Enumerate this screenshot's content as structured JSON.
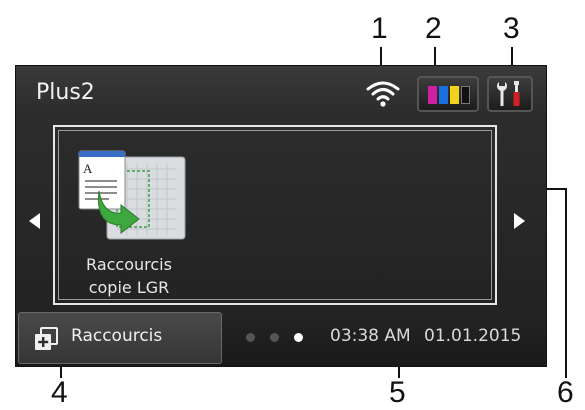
{
  "callouts": [
    "1",
    "2",
    "3",
    "4",
    "5",
    "6"
  ],
  "screen": {
    "title": "Plus2",
    "icons": {
      "wifi": "wifi-signal-icon",
      "ink": "ink-levels-icon",
      "settings": "tools-settings-icon"
    },
    "ink_colors": [
      "#d11fa3",
      "#1a6fe0",
      "#f3d21b",
      "#111111"
    ],
    "shortcut_tile": {
      "label_line1": "Raccourcis",
      "label_line2": "copie LGR"
    },
    "bottom": {
      "shortcuts_label": "Raccourcis",
      "time": "03:38 AM",
      "date": "01.01.2015",
      "page_dots": 3,
      "active_dot": 3
    }
  }
}
